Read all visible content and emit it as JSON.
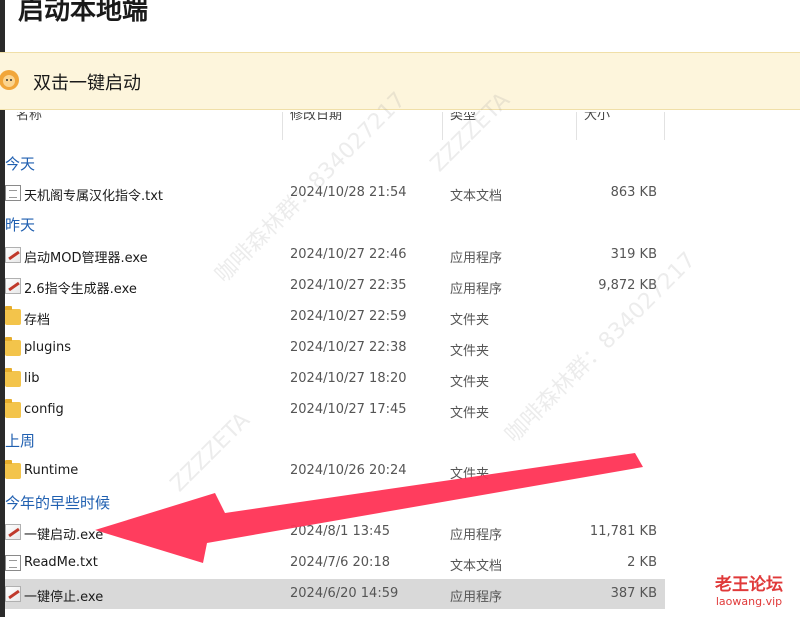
{
  "page_title": "启动本地端",
  "banner": {
    "text": "双击一键启动",
    "icon": "lion-mascot-icon"
  },
  "columns": [
    {
      "label": "名称"
    },
    {
      "label": "修改日期"
    },
    {
      "label": "类型"
    },
    {
      "label": "大小"
    }
  ],
  "groups": [
    {
      "label": "今天",
      "rows": [
        {
          "name": "天机阁专属汉化指令.txt",
          "date": "2024/10/28 21:54",
          "type": "文本文档",
          "size": "863 KB",
          "icon": "txt"
        }
      ]
    },
    {
      "label": "昨天",
      "rows": [
        {
          "name": "启动MOD管理器.exe",
          "date": "2024/10/27 22:46",
          "type": "应用程序",
          "size": "319 KB",
          "icon": "exe"
        },
        {
          "name": "2.6指令生成器.exe",
          "date": "2024/10/27 22:35",
          "type": "应用程序",
          "size": "9,872 KB",
          "icon": "exe"
        },
        {
          "name": "存档",
          "date": "2024/10/27 22:59",
          "type": "文件夹",
          "size": "",
          "icon": "folder"
        },
        {
          "name": "plugins",
          "date": "2024/10/27 22:38",
          "type": "文件夹",
          "size": "",
          "icon": "folder"
        },
        {
          "name": "lib",
          "date": "2024/10/27 18:20",
          "type": "文件夹",
          "size": "",
          "icon": "folder"
        },
        {
          "name": "config",
          "date": "2024/10/27 17:45",
          "type": "文件夹",
          "size": "",
          "icon": "folder"
        }
      ]
    },
    {
      "label": "上周",
      "rows": [
        {
          "name": "Runtime",
          "date": "2024/10/26 20:24",
          "type": "文件夹",
          "size": "",
          "icon": "folder"
        }
      ]
    },
    {
      "label": "今年的早些时候",
      "rows": [
        {
          "name": "一键启动.exe",
          "date": "2024/8/1 13:45",
          "type": "应用程序",
          "size": "11,781 KB",
          "icon": "exe"
        },
        {
          "name": "ReadMe.txt",
          "date": "2024/7/6 20:18",
          "type": "文本文档",
          "size": "2 KB",
          "icon": "txt"
        },
        {
          "name": "一键停止.exe",
          "date": "2024/6/20 14:59",
          "type": "应用程序",
          "size": "387 KB",
          "icon": "exe",
          "selected": true
        }
      ]
    }
  ],
  "watermarks": [
    "咖啡森林群：8340272​17",
    "ZZZZETA"
  ],
  "logo": {
    "title": "老王论坛",
    "url": "laowang.vip"
  },
  "colors": {
    "banner_bg": "#fdf5dc",
    "group_label": "#1f5fb0",
    "arrow": "#ff3355",
    "selected_row": "#d9d9d9"
  }
}
